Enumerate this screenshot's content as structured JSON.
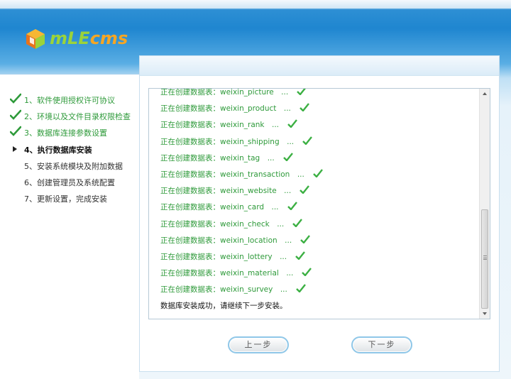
{
  "logo": {
    "part1": "mLE",
    "part2": "cms"
  },
  "steps": [
    {
      "label": "1、软件使用授权许可协议",
      "state": "done"
    },
    {
      "label": "2、环境以及文件目录权限检查",
      "state": "done"
    },
    {
      "label": "3、数据库连接参数设置",
      "state": "done"
    },
    {
      "label": "4、执行数据库安装",
      "state": "current"
    },
    {
      "label": "5、安装系统模块及附加数据",
      "state": "todo"
    },
    {
      "label": "6、创建管理员及系统配置",
      "state": "todo"
    },
    {
      "label": "7、更新设置，完成安装",
      "state": "todo"
    }
  ],
  "log": {
    "lines": [
      "正在创建数据表：weixin_picture　...",
      "正在创建数据表：weixin_product　...",
      "正在创建数据表：weixin_rank　...",
      "正在创建数据表：weixin_shipping　...",
      "正在创建数据表：weixin_tag　...",
      "正在创建数据表：weixin_transaction　...",
      "正在创建数据表：weixin_website　...",
      "正在创建数据表：weixin_card　...",
      "正在创建数据表：weixin_check　...",
      "正在创建数据表：weixin_location　...",
      "正在创建数据表：weixin_lottery　...",
      "正在创建数据表：weixin_material　...",
      "正在创建数据表：weixin_survey　..."
    ],
    "done_message": "数据库安装成功，请继续下一步安装。"
  },
  "buttons": {
    "prev": "上一步",
    "next": "下一步"
  },
  "colors": {
    "success": "#2e9a3a",
    "header_blue": "#1f86d0",
    "button_border": "#8fc7e8"
  }
}
